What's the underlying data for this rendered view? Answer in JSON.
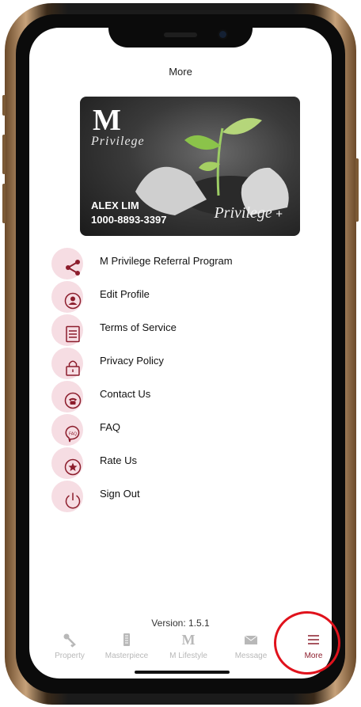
{
  "header": {
    "title": "More"
  },
  "card": {
    "logo_letter": "M",
    "logo_script": "Privilege",
    "holder_name": "ALEX LIM",
    "holder_number": "1000-8893-3397",
    "brand_script": "Privilege",
    "brand_plus": "+"
  },
  "menu": {
    "items": [
      {
        "label": "M Privilege Referral Program",
        "icon": "share-icon"
      },
      {
        "label": "Edit Profile",
        "icon": "user-profile-icon"
      },
      {
        "label": "Terms of Service",
        "icon": "document-icon"
      },
      {
        "label": "Privacy Policy",
        "icon": "lock-icon"
      },
      {
        "label": "Contact Us",
        "icon": "phone-icon"
      },
      {
        "label": "FAQ",
        "icon": "faq-icon"
      },
      {
        "label": "Rate Us",
        "icon": "star-icon"
      },
      {
        "label": "Sign Out",
        "icon": "power-icon"
      }
    ]
  },
  "footer": {
    "version": "Version: 1.5.1"
  },
  "tabbar": {
    "tabs": [
      {
        "label": "Property",
        "icon": "key-icon"
      },
      {
        "label": "Masterpiece",
        "icon": "building-icon"
      },
      {
        "label": "M Lifestyle",
        "icon": "m-logo-icon"
      },
      {
        "label": "Message",
        "icon": "envelope-icon"
      },
      {
        "label": "More",
        "icon": "menu-icon",
        "active": true
      }
    ]
  },
  "colors": {
    "accent": "#8c1d2c",
    "icon_blob": "#f6dde3",
    "inactive_tab": "#b8b8b8",
    "highlight_ring": "#e0121c"
  }
}
